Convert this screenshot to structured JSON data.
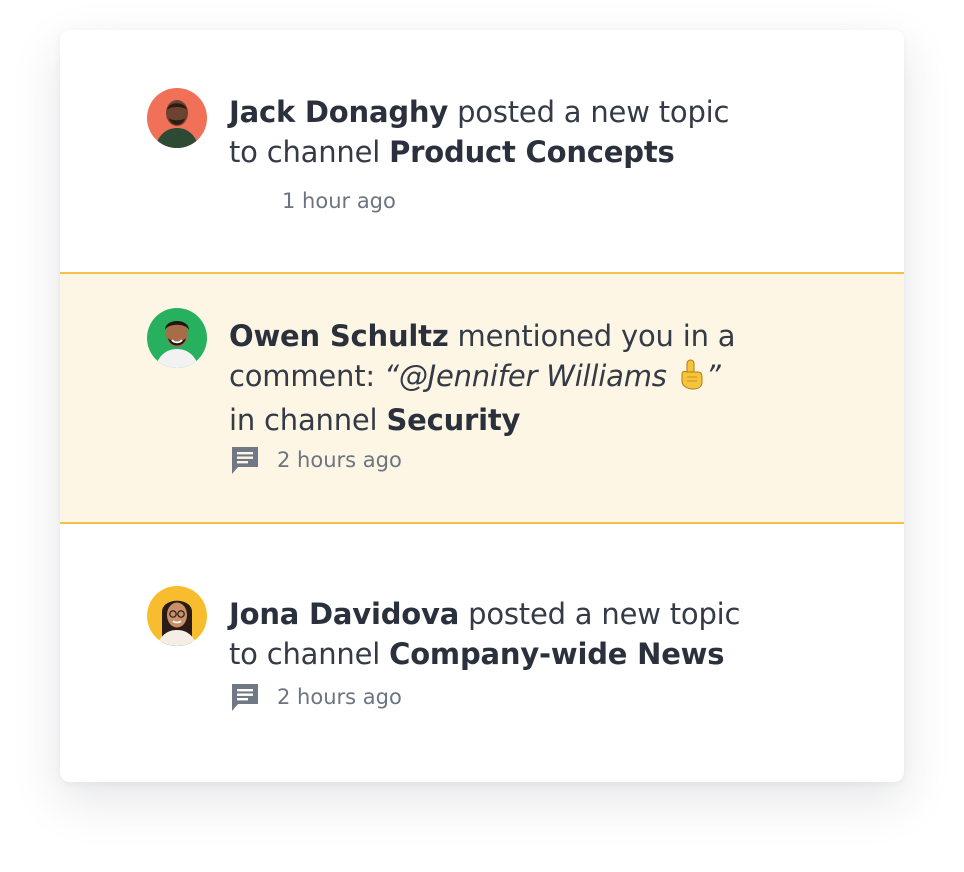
{
  "notifications": [
    {
      "actor": "Jack Donaghy",
      "action": "posted a new topic to channel",
      "action_line1": "posted a new topic",
      "action_line2": "to channel",
      "channel": "Product Concepts",
      "time": "1 hour ago",
      "highlighted": false,
      "avatar_bg": "#f07058"
    },
    {
      "actor": "Owen Schultz",
      "action_line1": "mentioned you in a",
      "action_line2": "comment:",
      "quote_open": "“",
      "mention": "@Jennifer  Williams",
      "quote_emoji": "☝️",
      "quote_close": "”",
      "action_line3": "in channel",
      "channel": "Security",
      "time": "2 hours ago",
      "highlighted": true,
      "avatar_bg": "#27b15e"
    },
    {
      "actor": "Jona Davidova",
      "action_line1": "posted a new topic",
      "action_line2": "to channel",
      "channel": "Company-wide News",
      "time": "2 hours ago",
      "highlighted": false,
      "avatar_bg": "#f7bd2e"
    }
  ],
  "colors": {
    "highlight_bg": "#fdf6e4",
    "highlight_border": "#f5c04a",
    "text": "#343b47",
    "muted": "#6c7480",
    "icon": "#6f7884"
  },
  "icons": {
    "comment": "comment-icon"
  }
}
